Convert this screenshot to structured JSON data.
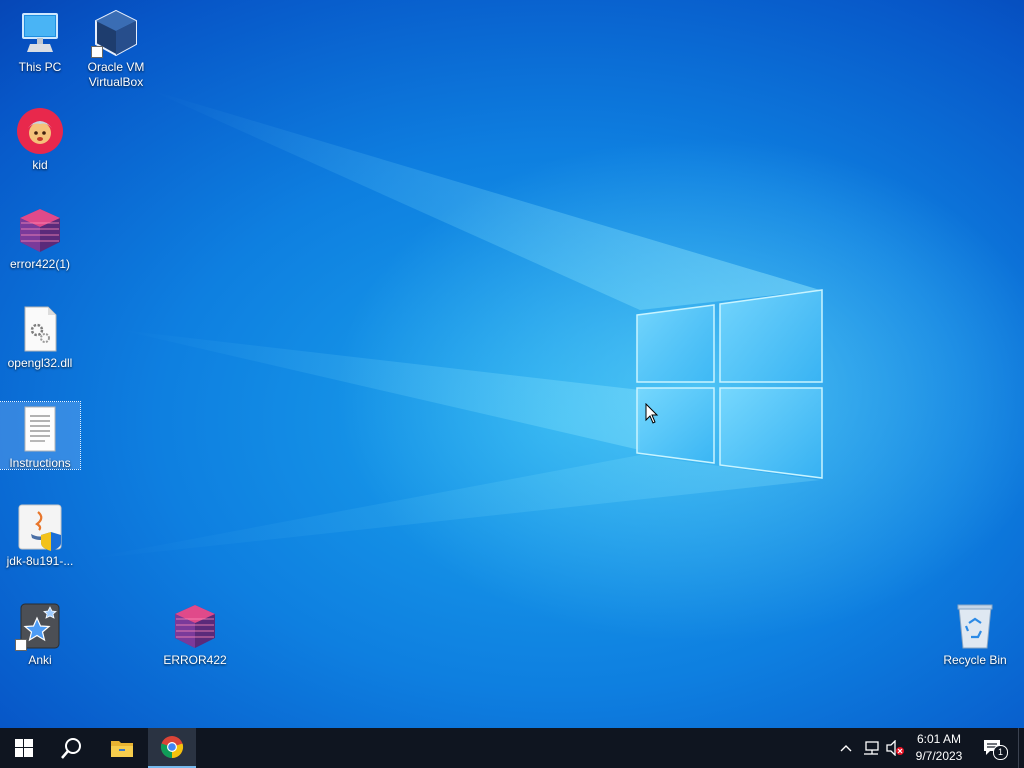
{
  "desktop": {
    "icons": {
      "this_pc": "This PC",
      "virtualbox_line1": "Oracle VM",
      "virtualbox_line2": "VirtualBox",
      "kid": "kid",
      "error422_1": "error422(1)",
      "opengl32": "opengl32.dll",
      "instructions": "Instructions",
      "jdk": "jdk-8u191-...",
      "anki": "Anki",
      "error422": "ERROR422",
      "recycle_bin": "Recycle Bin"
    }
  },
  "taskbar": {
    "pinned": [
      "start-icon",
      "search-icon",
      "file-explorer-icon",
      "chrome-icon"
    ],
    "tray": {
      "time": "6:01 AM",
      "date": "9/7/2023",
      "notification_count": "1"
    }
  },
  "colors": {
    "taskbar": "#0f1520",
    "accent": "#0078d7",
    "wallpaper_blue": "#0e7fe0"
  }
}
